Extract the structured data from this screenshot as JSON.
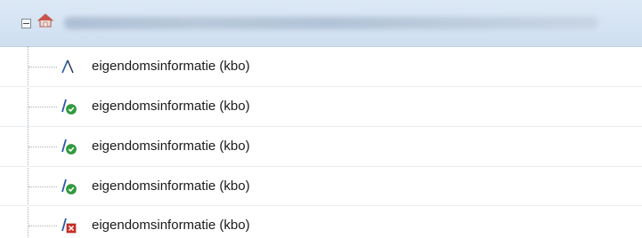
{
  "tree": {
    "root": {
      "label": "",
      "expanded": true,
      "icon": "home-icon"
    },
    "children": [
      {
        "label": "eigendomsinformatie (kbo)",
        "status_icon": "route-line-icon"
      },
      {
        "label": "eigendomsinformatie (kbo)",
        "status_icon": "line-check-icon"
      },
      {
        "label": "eigendomsinformatie (kbo)",
        "status_icon": "line-check-icon"
      },
      {
        "label": "eigendomsinformatie (kbo)",
        "status_icon": "line-check-icon"
      },
      {
        "label": "eigendomsinformatie (kbo)",
        "status_icon": "line-error-icon"
      }
    ]
  },
  "colors": {
    "root_background": "#d5e3f3",
    "check_green": "#2e9e3a",
    "error_red": "#d0302a",
    "line_blue": "#2a5ba8"
  }
}
